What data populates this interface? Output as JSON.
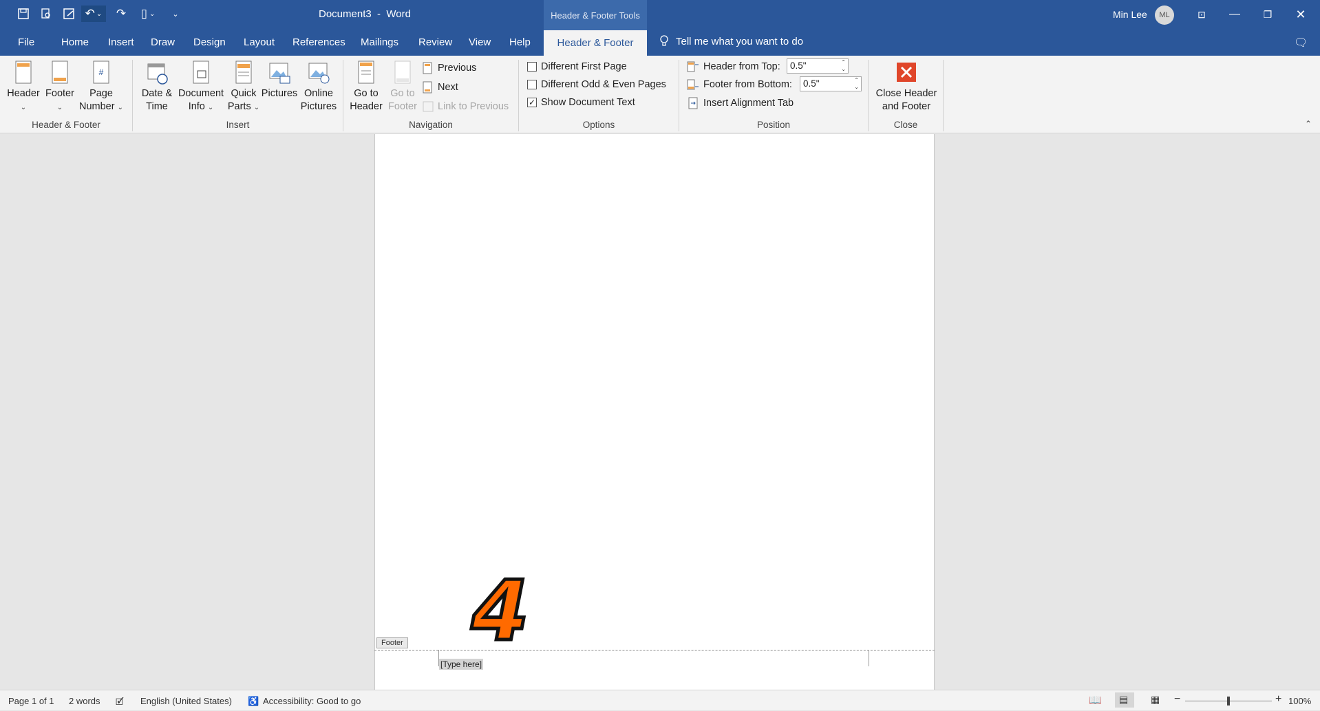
{
  "window": {
    "doc_title": "Document3  -  Word",
    "contextual_title": "Header & Footer Tools",
    "user_name": "Min Lee",
    "user_initials": "ML"
  },
  "tabs": [
    "File",
    "Home",
    "Insert",
    "Draw",
    "Design",
    "Layout",
    "References",
    "Mailings",
    "Review",
    "View",
    "Help"
  ],
  "active_tab": "Header & Footer",
  "tell_me": "Tell me what you want to do",
  "ribbon": {
    "header_footer_group": {
      "label": "Header & Footer",
      "header": "Header",
      "footer": "Footer",
      "page_number_1": "Page",
      "page_number_2": "Number"
    },
    "insert_group": {
      "label": "Insert",
      "date_time_1": "Date &",
      "date_time_2": "Time",
      "doc_info_1": "Document",
      "doc_info_2": "Info",
      "quick_parts_1": "Quick",
      "quick_parts_2": "Parts",
      "pictures": "Pictures",
      "online_pictures_1": "Online",
      "online_pictures_2": "Pictures"
    },
    "navigation_group": {
      "label": "Navigation",
      "go_to_header_1": "Go to",
      "go_to_header_2": "Header",
      "go_to_footer_1": "Go to",
      "go_to_footer_2": "Footer",
      "previous": "Previous",
      "next": "Next",
      "link_to_previous": "Link to Previous"
    },
    "options_group": {
      "label": "Options",
      "different_first_page": "Different First Page",
      "different_odd_even": "Different Odd & Even Pages",
      "show_document_text": "Show Document Text"
    },
    "position_group": {
      "label": "Position",
      "header_from_top": "Header from Top:",
      "header_from_top_value": "0.5\"",
      "footer_from_bottom": "Footer from Bottom:",
      "footer_from_bottom_value": "0.5\"",
      "insert_alignment_tab": "Insert Alignment Tab"
    },
    "close_group": {
      "label": "Close",
      "close_1": "Close Header",
      "close_2": "and Footer"
    }
  },
  "document": {
    "footer_tag": "Footer",
    "footer_placeholder": "[Type here]",
    "step_overlay": "4"
  },
  "status": {
    "page": "Page 1 of 1",
    "words": "2 words",
    "language": "English (United States)",
    "accessibility": "Accessibility: Good to go",
    "zoom": "100%"
  }
}
